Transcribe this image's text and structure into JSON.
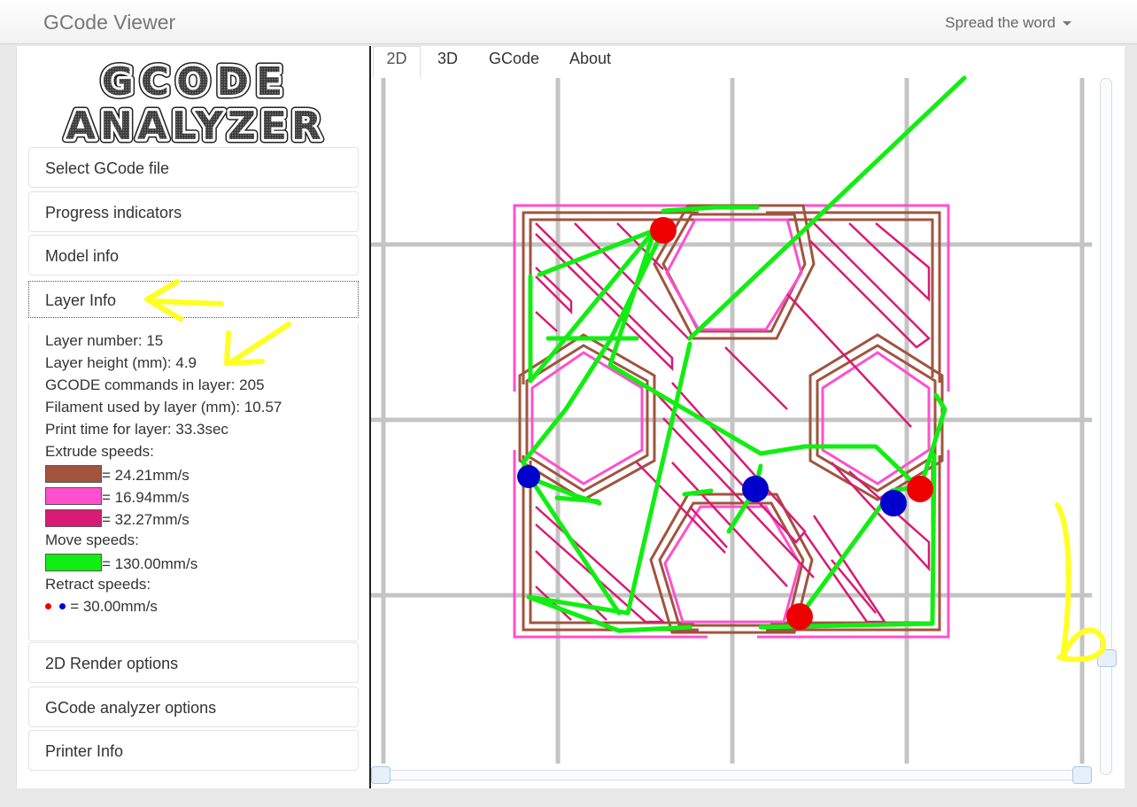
{
  "navbar": {
    "brand": "GCode Viewer",
    "menu_label": "Spread the word"
  },
  "logo": {
    "line1": "GCODE",
    "line2": "ANALYZER"
  },
  "sidebar": {
    "sections": [
      {
        "label": "Select GCode file"
      },
      {
        "label": "Progress indicators"
      },
      {
        "label": "Model info"
      },
      {
        "label": "Layer Info"
      },
      {
        "label": "2D Render options"
      },
      {
        "label": "GCode analyzer options"
      },
      {
        "label": "Printer Info"
      }
    ]
  },
  "layer_info": {
    "layer_number": "Layer number: 15",
    "layer_height": "Layer height (mm): 4.9",
    "gcode_commands": "GCODE commands in layer: 205",
    "filament_used": "Filament used by layer (mm): 10.57",
    "print_time": "Print time for layer: 33.3sec",
    "extrude_title": "Extrude speeds:",
    "extrude_speeds": [
      {
        "color": "#a0543e",
        "text": "= 24.21mm/s"
      },
      {
        "color": "#ff4fcf",
        "text": "= 16.94mm/s"
      },
      {
        "color": "#d81b74",
        "text": "= 32.27mm/s"
      }
    ],
    "move_title": "Move speeds:",
    "move_speeds": [
      {
        "color": "#11ee11",
        "text": "= 130.00mm/s"
      }
    ],
    "retract_title": "Retract speeds:",
    "retract_text": "= 30.00mm/s",
    "retract_colors": [
      "#ee0000",
      "#0000cc"
    ]
  },
  "tabs": [
    {
      "label": "2D",
      "active": true
    },
    {
      "label": "3D",
      "active": false
    },
    {
      "label": "GCode",
      "active": false
    },
    {
      "label": "About",
      "active": false
    }
  ],
  "colors": {
    "grid": "#c4c4c4",
    "perimeter_outer": "#ff4fcf",
    "perimeter_inner": "#a0543e",
    "infill": "#d81b74",
    "travel": "#11ee11",
    "retract_red": "#ee0000",
    "retract_blue": "#0000cc",
    "annotation": "#ffff22"
  }
}
